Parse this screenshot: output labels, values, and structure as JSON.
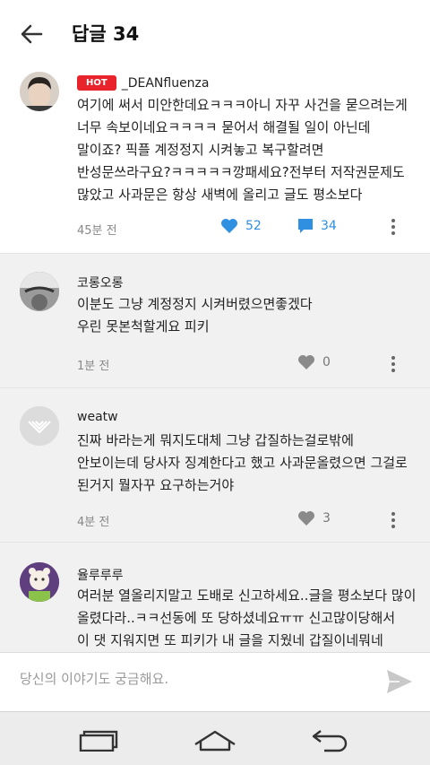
{
  "header": {
    "title": "답글 34"
  },
  "comments": [
    {
      "hot_label": "HOT",
      "author": "_DEANfluenza",
      "text": "여기에 써서 미안한데요ㅋㅋㅋ아니 자꾸 사건을 묻으려는게\n너무 속보이네요ㅋㅋㅋㅋ 묻어서 해결될 일이 아닌데\n말이죠? 픽플 계정정지 시켜놓고 복구할려면\n반성문쓰라구요?ㅋㅋㅋㅋㅋ깡패세요?전부터 저작권문제도\n많았고 사과문은 항상 새벽에 올리고 글도 평소보다",
      "time": "45분 전",
      "likes": "52",
      "replies": "34"
    },
    {
      "author": "코롱오롱",
      "text": "이분도 그냥 계정정지 시켜버렸으면좋겠다\n우린 못본척할게요 피키",
      "time": "1분 전",
      "likes": "0"
    },
    {
      "author": "weatw",
      "text": "진짜 바라는게 뭐지도대체 그냥 갑질하는걸로밖에\n안보이는데 당사자 징계한다고 했고 사과문올렸으면 그걸로\n된거지 뭘자꾸 요구하는거야",
      "time": "4분 전",
      "likes": "3"
    },
    {
      "author": "율루루루",
      "text": "여러분 열올리지말고 도배로 신고하세요..글을 평소보다 많이\n올렸다라..ㅋㅋ선동에 또 당하셨네요ㅠㅠ 신고많이당해서\n이 댓 지워지면 또 피키가 내 글을 지웠네 갑질이네뭐네"
    }
  ],
  "input": {
    "placeholder": "당신의 이야기도 궁금해요."
  },
  "colors": {
    "accent": "#2f8fe0",
    "hot": "#e8232b",
    "muted_bg": "#f1f1f1"
  },
  "icons": [
    "back-arrow-icon",
    "heart-icon",
    "reply-bubble-icon",
    "more-vertical-icon",
    "send-icon",
    "recent-apps-icon",
    "home-icon",
    "back-icon"
  ]
}
